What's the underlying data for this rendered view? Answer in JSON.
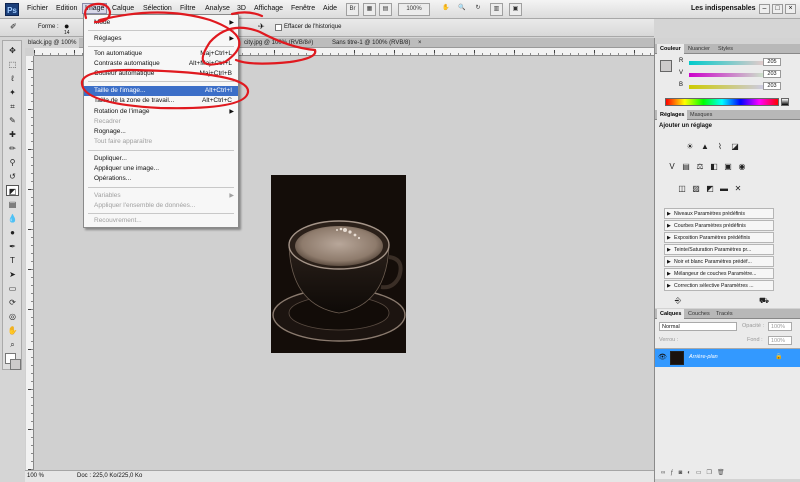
{
  "app": {
    "logo": "Ps",
    "workspace": "Les indispensables"
  },
  "menubar": {
    "items": [
      "Fichier",
      "Edition",
      "Image",
      "Calque",
      "Sélection",
      "Filtre",
      "Analyse",
      "3D",
      "Affichage",
      "Fenêtre",
      "Aide"
    ],
    "zoom": "100%"
  },
  "options": {
    "brush_size": "14",
    "mode_label": "Forme :",
    "history_label": "Effacer de l'historique"
  },
  "tabs": [
    {
      "label": "black.jpg @ 100%"
    },
    {
      "label": "city.jpg @ 100% (RVB/8#)"
    },
    {
      "label": "Sans titre-1 @ 100% (RVB/8)"
    }
  ],
  "image_menu": {
    "items": [
      {
        "label": "Mode",
        "submenu": true
      },
      {
        "label": "Réglages",
        "submenu": true
      },
      {
        "label": "Ton automatique",
        "shortcut": "Maj+Ctrl+L"
      },
      {
        "label": "Contraste automatique",
        "shortcut": "Alt+Maj+Ctrl+L"
      },
      {
        "label": "Couleur automatique",
        "shortcut": "Maj+Ctrl+B"
      },
      {
        "label": "Taille de l'image...",
        "shortcut": "Alt+Ctrl+I",
        "highlighted": true
      },
      {
        "label": "Taille de la zone de travail...",
        "shortcut": "Alt+Ctrl+C"
      },
      {
        "label": "Rotation de l'image",
        "submenu": true
      },
      {
        "label": "Recadrer",
        "disabled": true
      },
      {
        "label": "Rognage..."
      },
      {
        "label": "Tout faire apparaître",
        "disabled": true
      },
      {
        "label": "Dupliquer..."
      },
      {
        "label": "Appliquer une image..."
      },
      {
        "label": "Opérations..."
      },
      {
        "label": "Variables",
        "submenu": true,
        "disabled": true
      },
      {
        "label": "Appliquer l'ensemble de données...",
        "disabled": true
      },
      {
        "label": "Recouvrement...",
        "disabled": true
      }
    ]
  },
  "color_panel": {
    "tabs": [
      "Couleur",
      "Nuancier",
      "Styles"
    ],
    "channels": [
      {
        "label": "R",
        "value": "205"
      },
      {
        "label": "V",
        "value": "203"
      },
      {
        "label": "B",
        "value": "203"
      }
    ]
  },
  "adjust_panel": {
    "tabs": [
      "Réglages",
      "Masques"
    ],
    "title": "Ajouter un réglage",
    "presets": [
      "Niveaux Paramètres prédéfinis",
      "Courbes Paramètres prédéfinis",
      "Exposition Paramètres prédéfinis",
      "Teinte/Saturation Paramètres pr...",
      "Noir et blanc Paramètres prédéf...",
      "Mélangeur de couches Paramètre...",
      "Correction sélective Paramètres ..."
    ]
  },
  "layers_panel": {
    "tabs": [
      "Calques",
      "Couches",
      "Tracés"
    ],
    "blend_mode": "Normal",
    "opacity_label": "Opacité :",
    "opacity": "100%",
    "lock_label": "Verrou :",
    "fill_label": "Fond :",
    "fill": "100%",
    "layer_name": "Arrière-plan"
  },
  "status": {
    "zoom": "100 %",
    "doc": "Doc : 225,0 Ko/225,0 Ko"
  },
  "colors": {
    "highlight": "#3c6fc8",
    "layer_selected": "#3399ff",
    "annotation": "#e0191f"
  }
}
